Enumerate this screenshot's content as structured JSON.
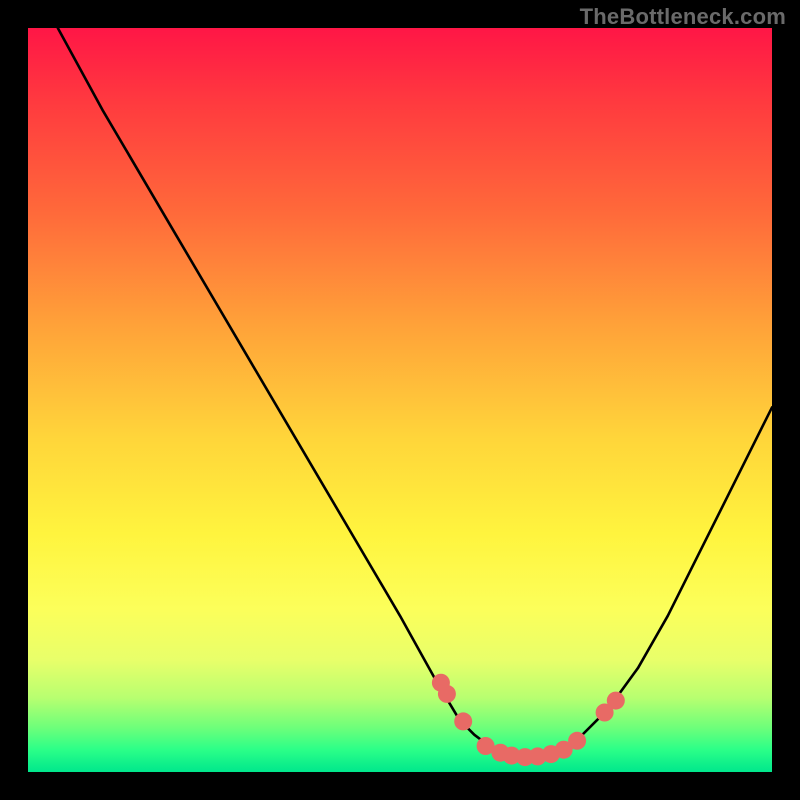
{
  "attribution": "TheBottleneck.com",
  "colors": {
    "frame": "#000000",
    "curve": "#000000",
    "marker": "#e86a65",
    "gradient_top": "#ff1646",
    "gradient_bottom": "#00e78c"
  },
  "chart_data": {
    "type": "line",
    "title": "",
    "xlabel": "",
    "ylabel": "",
    "xlim": [
      0,
      100
    ],
    "ylim": [
      0,
      100
    ],
    "grid": false,
    "legend": false,
    "series": [
      {
        "name": "bottleneck-curve",
        "x": [
          4,
          10,
          20,
          30,
          40,
          50,
          55,
          58,
          60,
          62,
          64,
          66,
          68,
          70,
          72,
          74,
          78,
          82,
          86,
          90,
          94,
          98,
          100
        ],
        "y": [
          100,
          89,
          72,
          55,
          38,
          21,
          12,
          7,
          5,
          3.5,
          2.5,
          2,
          2,
          2.3,
          3,
          4.5,
          8.5,
          14,
          21,
          29,
          37,
          45,
          49
        ]
      }
    ],
    "markers": {
      "name": "highlighted-points",
      "x": [
        55.5,
        56.3,
        58.5,
        61.5,
        63.5,
        65.0,
        66.8,
        68.5,
        70.3,
        72.0,
        73.8,
        77.5,
        79.0
      ],
      "y": [
        12.0,
        10.5,
        6.8,
        3.5,
        2.6,
        2.2,
        2.0,
        2.1,
        2.4,
        3.0,
        4.2,
        8.0,
        9.6
      ]
    }
  }
}
